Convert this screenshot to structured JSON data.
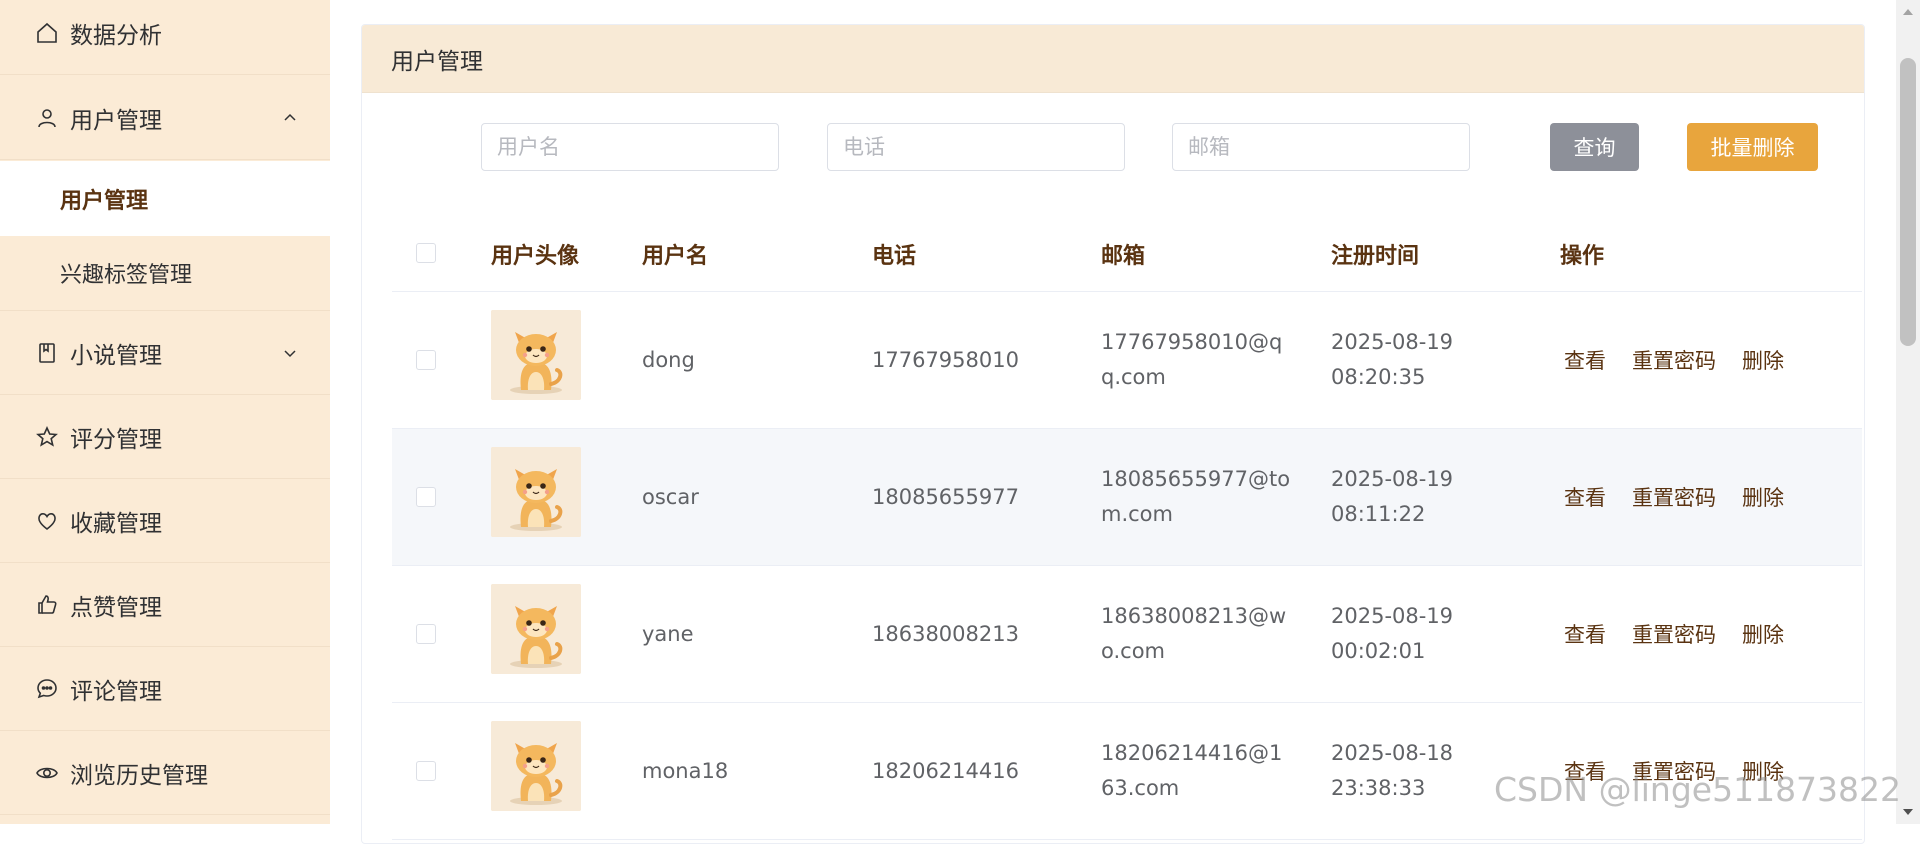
{
  "sidebar": {
    "items": [
      {
        "label": "数据分析",
        "icon": "home-icon"
      },
      {
        "label": "用户管理",
        "icon": "user-icon",
        "expanded": true,
        "children": [
          {
            "label": "用户管理",
            "active": true
          },
          {
            "label": "兴趣标签管理",
            "active": false
          }
        ]
      },
      {
        "label": "小说管理",
        "icon": "book-icon",
        "expanded": false
      },
      {
        "label": "评分管理",
        "icon": "star-icon"
      },
      {
        "label": "收藏管理",
        "icon": "heart-icon"
      },
      {
        "label": "点赞管理",
        "icon": "thumbs-up-icon"
      },
      {
        "label": "评论管理",
        "icon": "comment-icon"
      },
      {
        "label": "浏览历史管理",
        "icon": "eye-icon"
      }
    ]
  },
  "card": {
    "title": "用户管理"
  },
  "search": {
    "username_placeholder": "用户名",
    "phone_placeholder": "电话",
    "email_placeholder": "邮箱",
    "query_label": "查询",
    "batch_delete_label": "批量删除"
  },
  "table": {
    "columns": [
      "用户头像",
      "用户名",
      "电话",
      "邮箱",
      "注册时间",
      "操作"
    ],
    "rows": [
      {
        "username": "dong",
        "phone": "17767958010",
        "email_l1": "17767958010@q",
        "email_l2": "q.com",
        "date": "2025-08-19",
        "time": "08:20:35"
      },
      {
        "username": "oscar",
        "phone": "18085655977",
        "email_l1": "18085655977@to",
        "email_l2": "m.com",
        "date": "2025-08-19",
        "time": "08:11:22"
      },
      {
        "username": "yane",
        "phone": "18638008213",
        "email_l1": "18638008213@w",
        "email_l2": "o.com",
        "date": "2025-08-19",
        "time": "00:02:01"
      },
      {
        "username": "mona18",
        "phone": "18206214416",
        "email_l1": "18206214416@1",
        "email_l2": "63.com",
        "date": "2025-08-18",
        "time": "23:38:33"
      }
    ],
    "actions": {
      "view": "查看",
      "reset": "重置密码",
      "delete": "删除"
    }
  },
  "watermark": "CSDN @linge511873822",
  "colors": {
    "sidebar_bg": "#fbebd6",
    "accent_text": "#5a3311",
    "batch_btn": "#e8a53d",
    "query_btn": "#8d9099"
  }
}
